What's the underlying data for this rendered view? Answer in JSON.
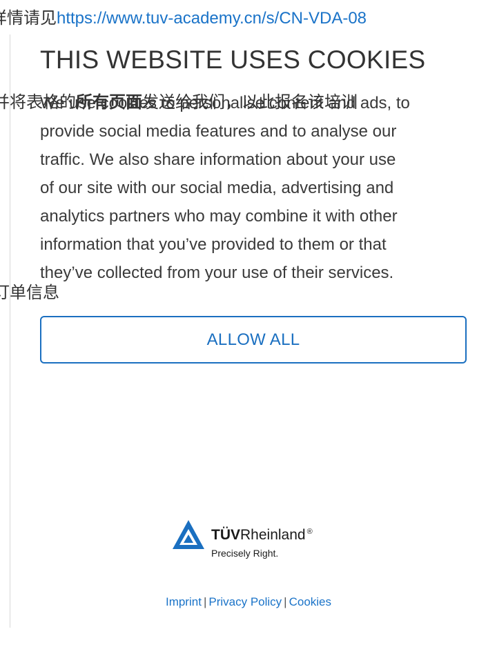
{
  "background": {
    "line1_text": "详情请见",
    "line1_link": "https://www.tuv-academy.cn/s/CN-VDA-08",
    "line2_pre": "并将表格的",
    "line2_bold": "所有页面",
    "line2_post": "发送给我们，以此报名该培训",
    "line3_text": "订单信息"
  },
  "cookie": {
    "title": "THIS WEBSITE USES COOKIES",
    "lines": [
      "We use cookies to personalise content and ads, to",
      "provide social media features and to analyse our",
      "traffic. We also share information about your use",
      "of our site with our social media, advertising and",
      "analytics partners who may combine it with other",
      "information that you’ve provided to them or that",
      "they’ve collected from your use of their services."
    ],
    "allow_label": "ALLOW ALL"
  },
  "logo": {
    "brand_bold": "TÜV",
    "brand_rest": "Rheinland",
    "registered": "®",
    "tagline": "Precisely Right.",
    "triangle_color": "#1a6fc0"
  },
  "footer": {
    "imprint": "Imprint",
    "privacy": "Privacy Policy",
    "cookies": "Cookies",
    "separator": "|"
  },
  "colors": {
    "accent": "#1a6fc0",
    "link": "#1a73c8",
    "text": "#333333"
  }
}
